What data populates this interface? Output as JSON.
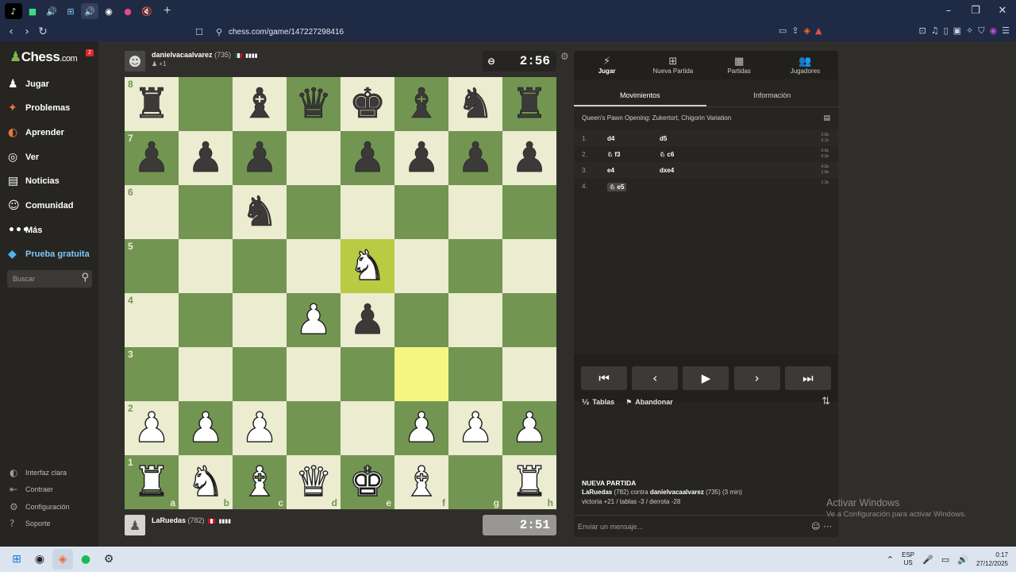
{
  "browser": {
    "tabs": [
      {
        "icon": "tiktok-icon",
        "glyph": "♪",
        "color": "#ffffff",
        "bg": "#000000"
      },
      {
        "icon": "app-icon",
        "glyph": "■",
        "color": "#3ddc84",
        "bg": "#1f2a44"
      },
      {
        "icon": "speaker-icon",
        "glyph": "🔊",
        "color": "#d6dbe8",
        "bg": "#1f2a44"
      },
      {
        "icon": "grid-icon",
        "glyph": "⊞",
        "color": "#7ec8f5",
        "bg": "#1f2a44"
      },
      {
        "icon": "speaker-icon",
        "glyph": "🔊",
        "color": "#d6dbe8",
        "bg": "#34405e"
      },
      {
        "icon": "chrome-icon",
        "glyph": "◉",
        "color": "#ffffff",
        "bg": "#1f2a44"
      },
      {
        "icon": "badge-icon",
        "glyph": "●",
        "color": "#e34a8a",
        "bg": "#1f2a44"
      },
      {
        "icon": "muted-icon",
        "glyph": "🔇",
        "color": "#d6dbe8",
        "bg": "#1f2a44"
      }
    ],
    "url": "chess.com/game/147227298416"
  },
  "sidebar": {
    "logo": "Chess",
    "logo_suffix": ".com",
    "badge": "2",
    "items": [
      {
        "label": "Jugar",
        "icon": "play-icon",
        "glyph": "♟"
      },
      {
        "label": "Problemas",
        "icon": "puzzle-icon",
        "glyph": "✦"
      },
      {
        "label": "Aprender",
        "icon": "learn-icon",
        "glyph": "◐"
      },
      {
        "label": "Ver",
        "icon": "watch-icon",
        "glyph": "◎"
      },
      {
        "label": "Noticias",
        "icon": "news-icon",
        "glyph": "▤"
      },
      {
        "label": "Comunidad",
        "icon": "community-icon",
        "glyph": "☺"
      },
      {
        "label": "Más",
        "icon": "more-icon",
        "glyph": "•••"
      },
      {
        "label": "Prueba gratuita",
        "icon": "diamond-icon",
        "glyph": "◆"
      }
    ],
    "search_placeholder": "Buscar",
    "footer": [
      {
        "label": "Interfaz clara",
        "icon": "theme-icon",
        "glyph": "◐"
      },
      {
        "label": "Contraer",
        "icon": "collapse-icon",
        "glyph": "⇤"
      },
      {
        "label": "Configuración",
        "icon": "settings-icon",
        "glyph": "⚙"
      },
      {
        "label": "Soporte",
        "icon": "help-icon",
        "glyph": "?"
      }
    ]
  },
  "top_player": {
    "name": "danielvacaalvarez",
    "rating": "(735)",
    "sub": "+1",
    "clock": "2:56"
  },
  "bottom_player": {
    "name": "LaRuedas",
    "rating": "(782)",
    "clock": "2:51"
  },
  "board": {
    "ranks": [
      "8",
      "7",
      "6",
      "5",
      "4",
      "3",
      "2",
      "1"
    ],
    "files": [
      "a",
      "b",
      "c",
      "d",
      "e",
      "f",
      "g",
      "h"
    ],
    "position": [
      [
        "r",
        "",
        "b",
        "q",
        "k",
        "b",
        "n",
        "r"
      ],
      [
        "p",
        "p",
        "p",
        "",
        "p",
        "p",
        "p",
        "p"
      ],
      [
        "",
        "",
        "n",
        "",
        "",
        "",
        "",
        ""
      ],
      [
        "",
        "",
        "",
        "",
        "N",
        "",
        "",
        ""
      ],
      [
        "",
        "",
        "",
        "P",
        "p",
        "",
        "",
        ""
      ],
      [
        "",
        "",
        "",
        "",
        "",
        "",
        "",
        ""
      ],
      [
        "P",
        "P",
        "P",
        "",
        "",
        "P",
        "P",
        "P"
      ],
      [
        "R",
        "N",
        "B",
        "Q",
        "K",
        "B",
        "",
        "R"
      ]
    ],
    "highlights": [
      "e5",
      "f3"
    ]
  },
  "panel": {
    "tabs": [
      {
        "label": "Jugar",
        "glyph": "⚡"
      },
      {
        "label": "Nueva Partida",
        "glyph": "⊞"
      },
      {
        "label": "Partidas",
        "glyph": "▦"
      },
      {
        "label": "Jugadores",
        "glyph": "👥"
      }
    ],
    "subtabs": [
      "Movimientos",
      "Información"
    ],
    "opening": "Queen's Pawn Opening: Zukertort, Chigorin Variation",
    "moves": [
      {
        "num": "1.",
        "white": "d4",
        "black": "d5",
        "wt": "2.0s",
        "bt": "0.1s"
      },
      {
        "num": "2.",
        "white": "♘ f3",
        "black": "♘ c6",
        "wt": "0.9s",
        "bt": "0.3s"
      },
      {
        "num": "3.",
        "white": "e4",
        "black": "dxe4",
        "wt": "4.0s",
        "bt": "1.9s"
      },
      {
        "num": "4.",
        "white": "♘ e5",
        "black": "",
        "wt": "1.3s",
        "bt": ""
      }
    ],
    "draw_label": "Tablas",
    "resign_label": "Abandonar",
    "new_game_title": "NUEVA PARTIDA",
    "new_game_p1": "LaRuedas",
    "new_game_vs": " (782) contra ",
    "new_game_p2": "danielvacaalvarez",
    "new_game_tail": " (735) (3 min)",
    "record": "victoria +21 / tablas -3 / derrota -28",
    "message_placeholder": "Enviar un mensaje..."
  },
  "watermark": {
    "line1": "Activar Windows",
    "line2": "Ve a Configuración para activar Windows."
  },
  "taskbar": {
    "lang1": "ESP",
    "lang2": "US",
    "time": "0:17",
    "date": "27/12/2025"
  }
}
